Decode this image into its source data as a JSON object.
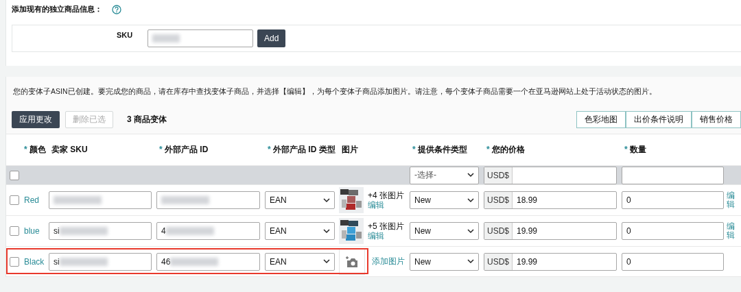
{
  "add_existing": {
    "title": "添加现有的独立商品信息：",
    "sku_label": "SKU",
    "sku_redacted": true,
    "add_button": "Add"
  },
  "notice": "您的变体子ASIN已创建。要完成您的商品，请在库存中查找变体子商品，并选择【编辑】，为每个变体子商品添加图片。请注意，每个变体子商品需要一个在亚马逊网站上处于活动状态的图片。",
  "toolbar": {
    "apply_button": "应用更改",
    "delete_button": {
      "label": "删除已选",
      "disabled": true
    },
    "variant_count": "3 商品变体",
    "right_buttons": [
      "色彩地图",
      "出价条件说明",
      "销售价格"
    ]
  },
  "table": {
    "columns": [
      {
        "label": "颜色",
        "required_mark": "*"
      },
      {
        "label": "卖家 SKU"
      },
      {
        "label": "外部产品 ID",
        "required_mark": "*"
      },
      {
        "label": "外部产品 ID 类型",
        "required_mark": "*"
      },
      {
        "label": "图片"
      },
      {
        "label": "提供条件类型",
        "required_mark": "*"
      },
      {
        "label": "您的价格",
        "required_mark": "*"
      },
      {
        "label": "数量",
        "required_mark": "*"
      }
    ],
    "bulk_row": {
      "checked": false,
      "condition_placeholder": "-选择-",
      "currency": "USD$"
    },
    "rows": [
      {
        "checked": false,
        "highlighted": false,
        "color_name": "Red",
        "sku": {
          "redacted": true
        },
        "ext_id": {
          "redacted": true
        },
        "ext_id_type": "EAN",
        "image": {
          "kind": "photos",
          "count_text": "+4 张图片",
          "link": "编辑"
        },
        "condition": "New",
        "currency": "USD$",
        "price": "18.99",
        "quantity": "0",
        "edit": "编辑"
      },
      {
        "checked": false,
        "highlighted": false,
        "color_name": "blue",
        "sku": {
          "value": "si",
          "redacted": true
        },
        "ext_id": {
          "value": "4",
          "redacted": true
        },
        "ext_id_type": "EAN",
        "image": {
          "kind": "photos",
          "count_text": "+5 张图片",
          "link": "编辑"
        },
        "condition": "New",
        "currency": "USD$",
        "price": "19.99",
        "quantity": "0",
        "edit": "编辑"
      },
      {
        "checked": false,
        "highlighted": true,
        "color_name": "Black",
        "sku": {
          "value": "si",
          "redacted": true
        },
        "ext_id": {
          "value": "46",
          "redacted": true
        },
        "ext_id_type": "EAN",
        "image": {
          "kind": "add",
          "link": "添加图片"
        },
        "condition": "New",
        "currency": "USD$",
        "price": "19.99",
        "quantity": "0"
      }
    ]
  }
}
